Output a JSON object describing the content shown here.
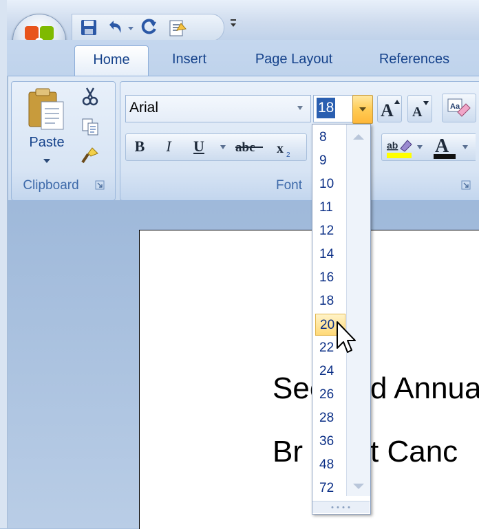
{
  "ribbon": {
    "tabs": [
      "Home",
      "Insert",
      "Page Layout",
      "References"
    ],
    "active_tab": "Home",
    "clipboard": {
      "paste_label": "Paste",
      "group_label": "Clipboard"
    },
    "font": {
      "group_label": "Font",
      "font_name": "Arial",
      "font_size": "18"
    }
  },
  "font_size_dropdown": {
    "options": [
      "8",
      "9",
      "10",
      "11",
      "12",
      "14",
      "16",
      "18",
      "20",
      "22",
      "24",
      "26",
      "28",
      "36",
      "48",
      "72"
    ],
    "highlighted": "20"
  },
  "document": {
    "lines": [
      "Sec",
      "d Annua",
      "Br",
      "t Canc"
    ]
  },
  "colors": {
    "ribbon_text": "#15428b",
    "highlight_fill": "#ffd977",
    "size_text": "#0b2f86"
  }
}
